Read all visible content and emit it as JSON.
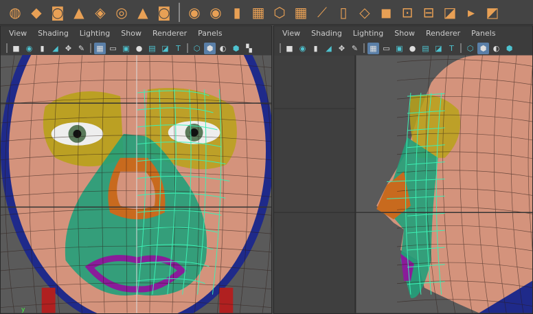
{
  "shelf": {
    "icons": [
      "poly-sphere-icon",
      "poly-cube-icon",
      "poly-cylinder-icon",
      "poly-cone-icon",
      "poly-plane-icon",
      "poly-torus-icon",
      "poly-pyramid-icon",
      "poly-pipe-icon",
      "combine-icon",
      "separate-icon",
      "extract-icon",
      "smooth-icon",
      "mirror-icon",
      "boolean-icon",
      "bevel-icon",
      "multi-cut-icon",
      "extrude-icon",
      "bridge-icon",
      "fill-hole-icon",
      "insert-edge-loop-icon",
      "offset-edge-loop-icon",
      "split-icon",
      "crease-icon"
    ]
  },
  "panels": [
    {
      "menu": [
        "View",
        "Shading",
        "Lighting",
        "Show",
        "Renderer",
        "Panels"
      ],
      "view": "front"
    },
    {
      "menu": [
        "View",
        "Shading",
        "Lighting",
        "Show",
        "Renderer",
        "Panels"
      ],
      "view": "side"
    }
  ],
  "axis_label": "y",
  "colors": {
    "wire": "#3cf0b4",
    "skin": "#d4937c",
    "eye": "#b8a21a",
    "nose": "#c86a1e",
    "cheek": "#22a07a",
    "lip": "#8a1c9a"
  }
}
